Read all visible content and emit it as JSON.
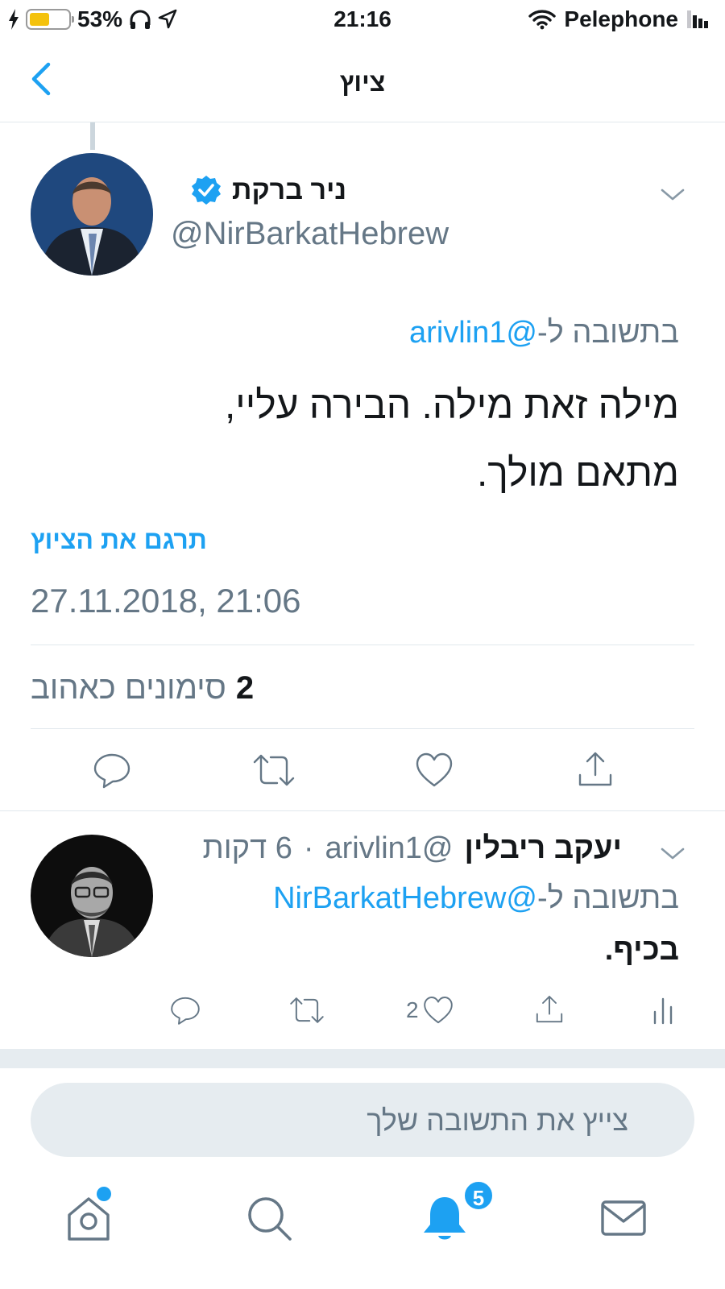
{
  "status_bar": {
    "battery_percent": "53%",
    "battery_level": 0.53,
    "time": "21:16",
    "carrier": "Pelephone"
  },
  "nav": {
    "title": "ציוץ",
    "back_icon": "chevron-left-icon"
  },
  "tweet": {
    "author_name": "ניר ברקת",
    "verified": true,
    "handle": "@NirBarkatHebrew",
    "reply_prefix": "בתשובה ל-",
    "reply_to": "@arivlin1",
    "text_line1": "מילה זאת מילה. הבירה עליי,",
    "text_line2": "מתאם מולך.",
    "translate_label": "תרגם את הציוץ",
    "timestamp": "27.11.2018, 21:06",
    "likes_count": "2",
    "likes_label": "סימונים כאהוב"
  },
  "reply": {
    "author_name": "יעקב ריבלין",
    "handle": "@arivlin1",
    "time_ago": "6 דקות",
    "reply_prefix": "בתשובה ל-",
    "reply_to": "@NirBarkatHebrew",
    "text": "בכיף.",
    "like_count": "2"
  },
  "composer": {
    "placeholder": "צייץ את התשובה שלך"
  },
  "tabbar": {
    "notifications_badge": "5"
  },
  "colors": {
    "accent": "#1da1f2",
    "secondary_text": "#657786",
    "divider": "#e1e8ed"
  }
}
